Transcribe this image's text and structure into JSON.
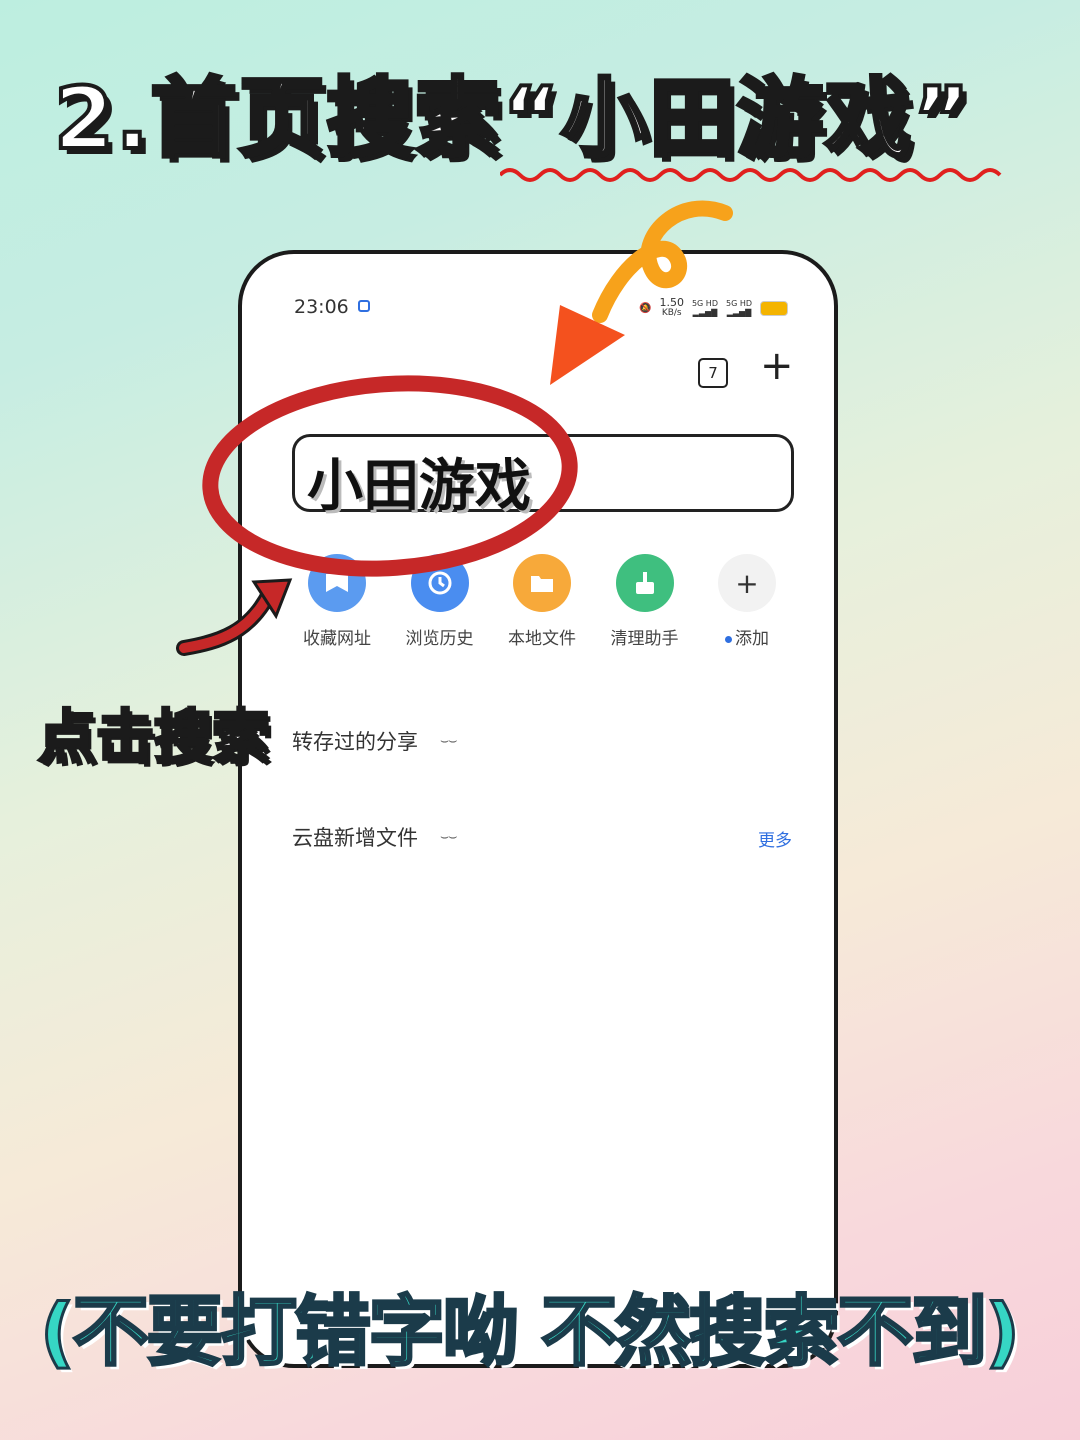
{
  "headline": "2.首页搜索“小田游戏”",
  "phone": {
    "status_bar": {
      "time": "23:06",
      "net_speed": "1.50",
      "net_unit": "KB/s",
      "sig1": "5G HD",
      "sig2": "5G HD"
    },
    "tab_count": "7",
    "search": {
      "value": "小田游戏"
    },
    "shortcuts": [
      {
        "label": "收藏网址",
        "icon": "bookmark-icon",
        "color": "#5b9bf0"
      },
      {
        "label": "浏览历史",
        "icon": "history-icon",
        "color": "#4a8df0"
      },
      {
        "label": "本地文件",
        "icon": "folder-icon",
        "color": "#f7a93a"
      },
      {
        "label": "清理助手",
        "icon": "broom-icon",
        "color": "#3fbf7f"
      },
      {
        "label": "添加",
        "icon": "plus-icon",
        "color": "#f0f0f0"
      }
    ],
    "sections": [
      {
        "label": "转存过的分享"
      },
      {
        "label": "云盘新增文件"
      }
    ],
    "more_label": "更多"
  },
  "side_label": "点击搜索",
  "bottom_note": "(不要打错字呦 不然搜索不到)",
  "colors": {
    "accent_red": "#c62828",
    "accent_orange": "#f57c00",
    "link_blue": "#2f6fe0",
    "note_teal": "#36d6c4"
  }
}
